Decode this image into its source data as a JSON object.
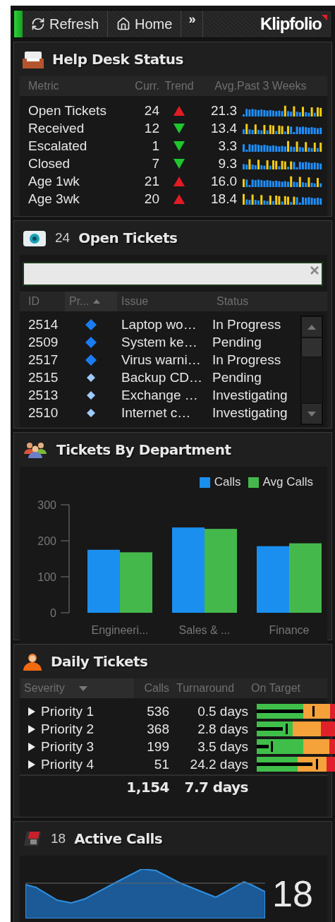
{
  "toolbar": {
    "status_on": true,
    "buttons": [
      {
        "kind": "refresh",
        "label": "Refresh"
      },
      {
        "kind": "home",
        "label": "Home"
      },
      {
        "kind": "more",
        "label": "»"
      }
    ],
    "logo": "Klipfolio"
  },
  "help_desk": {
    "title": "Help Desk Status",
    "columns": [
      "Metric",
      "Curr.",
      "Trend",
      "Avg.",
      "Past 3 Weeks"
    ],
    "rows": [
      {
        "metric": "Open Tickets",
        "current": "24",
        "rising": true,
        "average": "21.3"
      },
      {
        "metric": "Received",
        "current": "12",
        "rising": false,
        "average": "13.4"
      },
      {
        "metric": "Escalated",
        "current": "1",
        "rising": false,
        "average": "3.3"
      },
      {
        "metric": "Closed",
        "current": "7",
        "rising": false,
        "average": "9.3"
      },
      {
        "metric": "Age 1wk",
        "current": "21",
        "rising": true,
        "average": "16.0"
      },
      {
        "metric": "Age 3wk",
        "current": "20",
        "rising": true,
        "average": "18.4"
      }
    ]
  },
  "open_tickets": {
    "count": "24",
    "title": "Open Tickets",
    "columns": [
      {
        "label": "ID",
        "sorted": false
      },
      {
        "label": "Pr...",
        "sorted": true
      },
      {
        "label": "Issue",
        "sorted": false
      },
      {
        "label": "Status",
        "sorted": false
      }
    ],
    "rows": [
      {
        "id": "2514",
        "high_priority": true,
        "issue": "Laptop wo…",
        "status": "In Progress"
      },
      {
        "id": "2509",
        "high_priority": true,
        "issue": "System ke…",
        "status": "Pending"
      },
      {
        "id": "2517",
        "high_priority": true,
        "issue": "Virus warni…",
        "status": "In Progress"
      },
      {
        "id": "2515",
        "high_priority": false,
        "issue": "Backup CD…",
        "status": "Pending"
      },
      {
        "id": "2513",
        "high_priority": false,
        "issue": "Exchange …",
        "status": "Investigating"
      },
      {
        "id": "2510",
        "high_priority": false,
        "issue": "Internet c…",
        "status": "Investigating"
      }
    ]
  },
  "departments": {
    "title": "Tickets By Department",
    "chart_data": {
      "type": "bar",
      "categories": [
        "Engineeri...",
        "Sales & ...",
        "Finance"
      ],
      "series": [
        {
          "name": "Calls",
          "color": "#1a8fef",
          "values": [
            175,
            237,
            185
          ]
        },
        {
          "name": "Avg Calls",
          "color": "#45b84c",
          "values": [
            168,
            233,
            193
          ]
        }
      ],
      "ylim": [
        0,
        300
      ],
      "yticks": [
        0,
        100,
        200,
        300
      ]
    }
  },
  "daily_tickets": {
    "title": "Daily Tickets",
    "columns": [
      "Severity",
      "Calls",
      "Turnaround",
      "On Target"
    ],
    "rows": [
      {
        "label": "Priority 1",
        "calls": "536",
        "turnaround": "0.5 days",
        "good": {
          "level": 0.5
        },
        "fair": {
          "level": 0.79
        },
        "bar": {
          "level": 0.5
        },
        "target": {
          "level": 0.6
        }
      },
      {
        "label": "Priority 2",
        "calls": "368",
        "turnaround": "2.8 days",
        "good": {
          "level": 0.39
        },
        "fair": {
          "level": 0.69
        },
        "bar": {
          "level": 0.28
        },
        "target": {
          "level": 0.31
        }
      },
      {
        "label": "Priority 3",
        "calls": "199",
        "turnaround": "3.5 days",
        "good": {
          "level": 0.5
        },
        "fair": {
          "level": 0.78
        },
        "bar": {
          "level": 0.13
        },
        "target": {
          "level": 0.15
        }
      },
      {
        "label": "Priority 4",
        "calls": "51",
        "turnaround": "24.2 days",
        "good": {
          "level": 0.44
        },
        "fair": {
          "level": 0.75
        },
        "bar": {
          "level": 0.6
        },
        "target": {
          "level": 0.64
        }
      }
    ],
    "total_calls": "1,154",
    "total_turnaround": "7.7 days"
  },
  "active_calls": {
    "count": "18",
    "title": "Active Calls",
    "value": "18"
  }
}
